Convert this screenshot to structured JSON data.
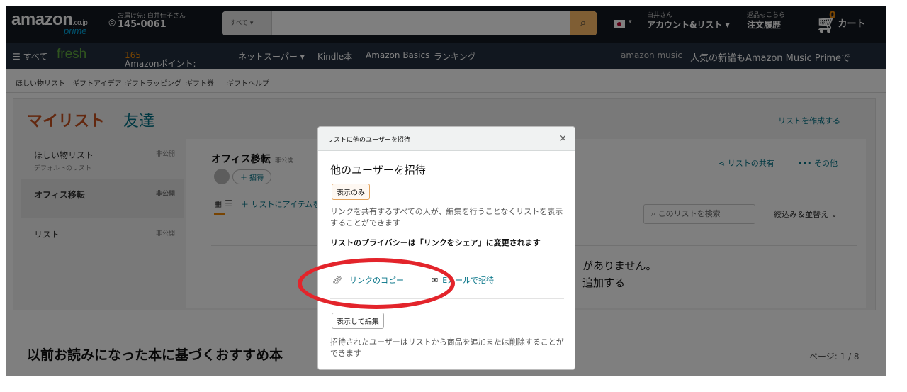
{
  "header": {
    "logo": "amazon",
    "logo_suffix": ".co.jp",
    "logo_prime": "prime",
    "deliver_to": "お届け先: 白井佳子さん",
    "zip": "145-0061",
    "search_category": "すべて ▾",
    "account_greeting": "白井さん",
    "account_label": "アカウント&リスト ▾",
    "returns_small": "返品もこちら",
    "orders_label": "注文履歴",
    "cart_count": "0",
    "cart_label": "カート"
  },
  "nav": {
    "all": "☰ すべて",
    "fresh": "fresh",
    "points_prefix": "Amazonポイント: ",
    "points_value": "165",
    "net_super": "ネットスーパー ▾",
    "kindle": "Kindle本",
    "basics": "Amazon Basics",
    "ranking": "ランキング",
    "music_logo": "amazon music",
    "promo": "人気の新譜もAmazon Music Primeで"
  },
  "subnav": [
    "ほしい物リスト",
    "ギフトアイデア",
    "ギフトラッピング",
    "ギフト券",
    "ギフトヘルプ"
  ],
  "tabs": {
    "mine": "マイリスト",
    "friends": "友達"
  },
  "create_list": "リストを作成する",
  "lists": [
    {
      "name": "ほしい物リスト",
      "sub": "デフォルトのリスト",
      "privacy": "非公開"
    },
    {
      "name": "オフィス移転",
      "sub": "",
      "privacy": "非公開"
    },
    {
      "name": "リスト",
      "sub": "",
      "privacy": "非公開"
    }
  ],
  "main": {
    "title": "オフィス移転",
    "privacy": "非公開",
    "invite_button": "＋ 招待",
    "view_icons": "▦ ☰",
    "add_link": "＋ リストにアイテムを追加",
    "share": "⋖ リストの共有",
    "more": "••• その他",
    "search_placeholder": "⌕ このリストを検索",
    "sort": "絞込み＆並替え ⌄",
    "empty_line1": "がありません。",
    "empty_line2": "追加する"
  },
  "recommendations": {
    "title": "以前お読みになった本に基づくおすすめ本",
    "page": "ページ: 1 / 8"
  },
  "modal": {
    "header": "リストに他のユーザーを招待",
    "close": "×",
    "title": "他のユーザーを招待",
    "view_only_button": "表示のみ",
    "view_only_desc": "リンクを共有するすべての人が、編集を行うことなくリストを表示することができます",
    "privacy_note": "リストのプライバシーは「リンクをシェア」に変更されます",
    "copy_link": "リンクのコピー",
    "email_invite": "Eメールで招待",
    "edit_button": "表示して編集",
    "edit_desc": "招待されたユーザーはリストから商品を追加または削除することができます"
  },
  "colors": {
    "highlight_ring": "#e3242b",
    "link": "#007185",
    "accent": "#f08804"
  }
}
